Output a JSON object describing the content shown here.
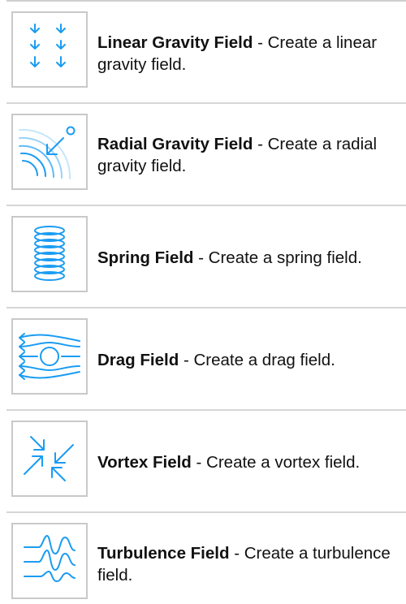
{
  "items": [
    {
      "name": "Linear Gravity Field",
      "sep": " - ",
      "desc": "Create a linear gravity field.",
      "icon": "linear-gravity-icon"
    },
    {
      "name": "Radial Gravity Field",
      "sep": " - ",
      "desc": "Create a radial gravity field.",
      "icon": "radial-gravity-icon"
    },
    {
      "name": "Spring Field",
      "sep": " - ",
      "desc": "Create a spring field.",
      "icon": "spring-icon"
    },
    {
      "name": "Drag Field",
      "sep": " - ",
      "desc": "Create a drag field.",
      "icon": "drag-icon"
    },
    {
      "name": "Vortex Field",
      "sep": " - ",
      "desc": "Create a vortex field.",
      "icon": "vortex-icon"
    },
    {
      "name": "Turbulence Field",
      "sep": " - ",
      "desc": "Create a turbulence field.",
      "icon": "turbulence-icon"
    }
  ],
  "colors": {
    "icon_accent": "#1a9cf2",
    "separator": "#d6d6d6",
    "icon_border": "#c9c9c9"
  }
}
